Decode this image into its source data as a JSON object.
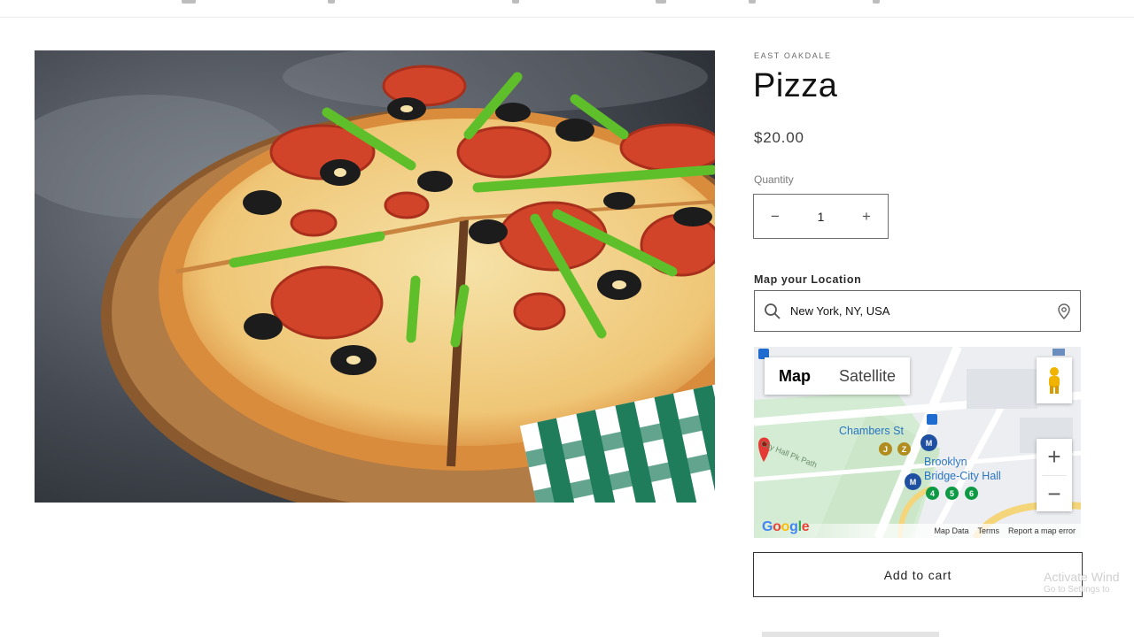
{
  "product": {
    "vendor": "EAST OAKDALE",
    "title": "Pizza",
    "price": "$20.00",
    "quantity_label": "Quantity",
    "quantity_value": "1",
    "decrease_symbol": "−",
    "increase_symbol": "+",
    "image_icon": "pizza-photo"
  },
  "location": {
    "label": "Map your Location",
    "search_value": "New York, NY, USA",
    "search_icon": "search-icon",
    "pin_icon": "location-pin-icon"
  },
  "map": {
    "type_tabs": [
      "Map",
      "Satellite"
    ],
    "active_tab": "Map",
    "labels": {
      "station_1": "Chambers St",
      "station_2_line1": "Brooklyn",
      "station_2_line2": "Bridge-City Hall",
      "street": "City Hall Pk Path"
    },
    "lines": {
      "j": "J",
      "z": "Z",
      "l4": "4",
      "l5": "5",
      "l6": "6",
      "m1": "M",
      "m2": "M"
    },
    "zoom_in": "+",
    "zoom_out": "−",
    "google_letters": [
      "G",
      "o",
      "o",
      "g",
      "l",
      "e"
    ],
    "footer": {
      "map_data": "Map Data",
      "terms": "Terms",
      "report": "Report a map error"
    }
  },
  "cart": {
    "label": "Add to cart"
  },
  "watermark": {
    "line1": "Activate Wind",
    "line2": "Go to Settings to"
  },
  "colors": {
    "accent_text": "#121212",
    "map_link": "#2a75c4",
    "subway_yellow": "#b08d1e",
    "subway_green": "#0e9a44",
    "subway_blue": "#1f4fa0"
  }
}
